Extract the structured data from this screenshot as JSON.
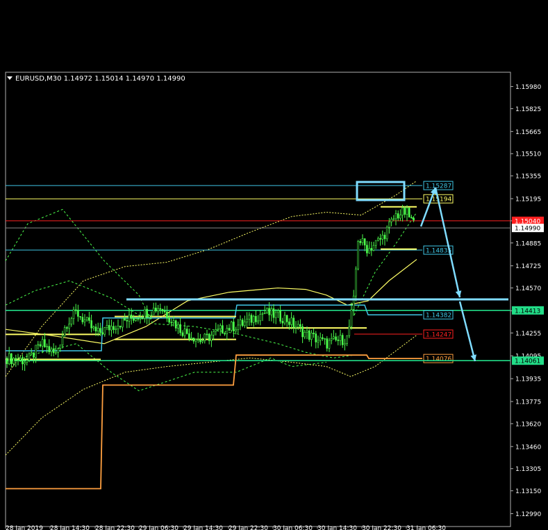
{
  "chart_data": {
    "type": "candlestick",
    "symbol": "EURUSD",
    "timeframe": "M30",
    "ohlc": {
      "open": "1.14972",
      "high": "1.15014",
      "low": "1.14970",
      "close": "1.14990"
    },
    "ylim": [
      1.129,
      1.1608
    ],
    "y_ticks": [
      "1.15980",
      "1.15825",
      "1.15665",
      "1.15510",
      "1.15355",
      "1.15195",
      "1.15040",
      "1.14885",
      "1.14725",
      "1.14570",
      "1.14410",
      "1.14255",
      "1.14095",
      "1.13935",
      "1.13775",
      "1.13620",
      "1.13460",
      "1.13305",
      "1.13150",
      "1.12990"
    ],
    "x_ticks": [
      "28 Jan 2019",
      "28 Jan 14:30",
      "28 Jan 22:30",
      "29 Jan 06:30",
      "29 Jan 14:30",
      "29 Jan 22:30",
      "30 Jan 06:30",
      "30 Jan 14:30",
      "30 Jan 22:30",
      "31 Jan 06:30"
    ],
    "current_price": {
      "label": "1.14990",
      "value": 1.1499,
      "color": "#ffffff"
    },
    "bid_label": {
      "label": "1.15040",
      "value": 1.1504,
      "color": "#ff2020"
    },
    "levels": [
      {
        "label": "1.15287",
        "value": 1.15287,
        "color": "#3fc7e6"
      },
      {
        "label": "1.15194",
        "value": 1.15194,
        "color": "#ffff66"
      },
      {
        "label": "1.14835",
        "value": 1.14835,
        "color": "#3fc7e6"
      },
      {
        "label": "1.14413",
        "value": 1.14413,
        "color": "#22dd88",
        "axis": true
      },
      {
        "label": "1.14382",
        "value": 1.14382,
        "color": "#3fc7e6"
      },
      {
        "label": "1.14247",
        "value": 1.14247,
        "color": "#ff2020"
      },
      {
        "label": "1.14076",
        "value": 1.14076,
        "color": "#ffa040"
      },
      {
        "label": "1.14061",
        "value": 1.14061,
        "color": "#22dd88",
        "axis": true
      }
    ],
    "colors": {
      "bull": "#4cff4c",
      "bear": "#4cff4c",
      "bands": "#ffff66",
      "channel": "#4cff4c",
      "forecast": "#7fdcff",
      "support": "#ffa040"
    }
  }
}
